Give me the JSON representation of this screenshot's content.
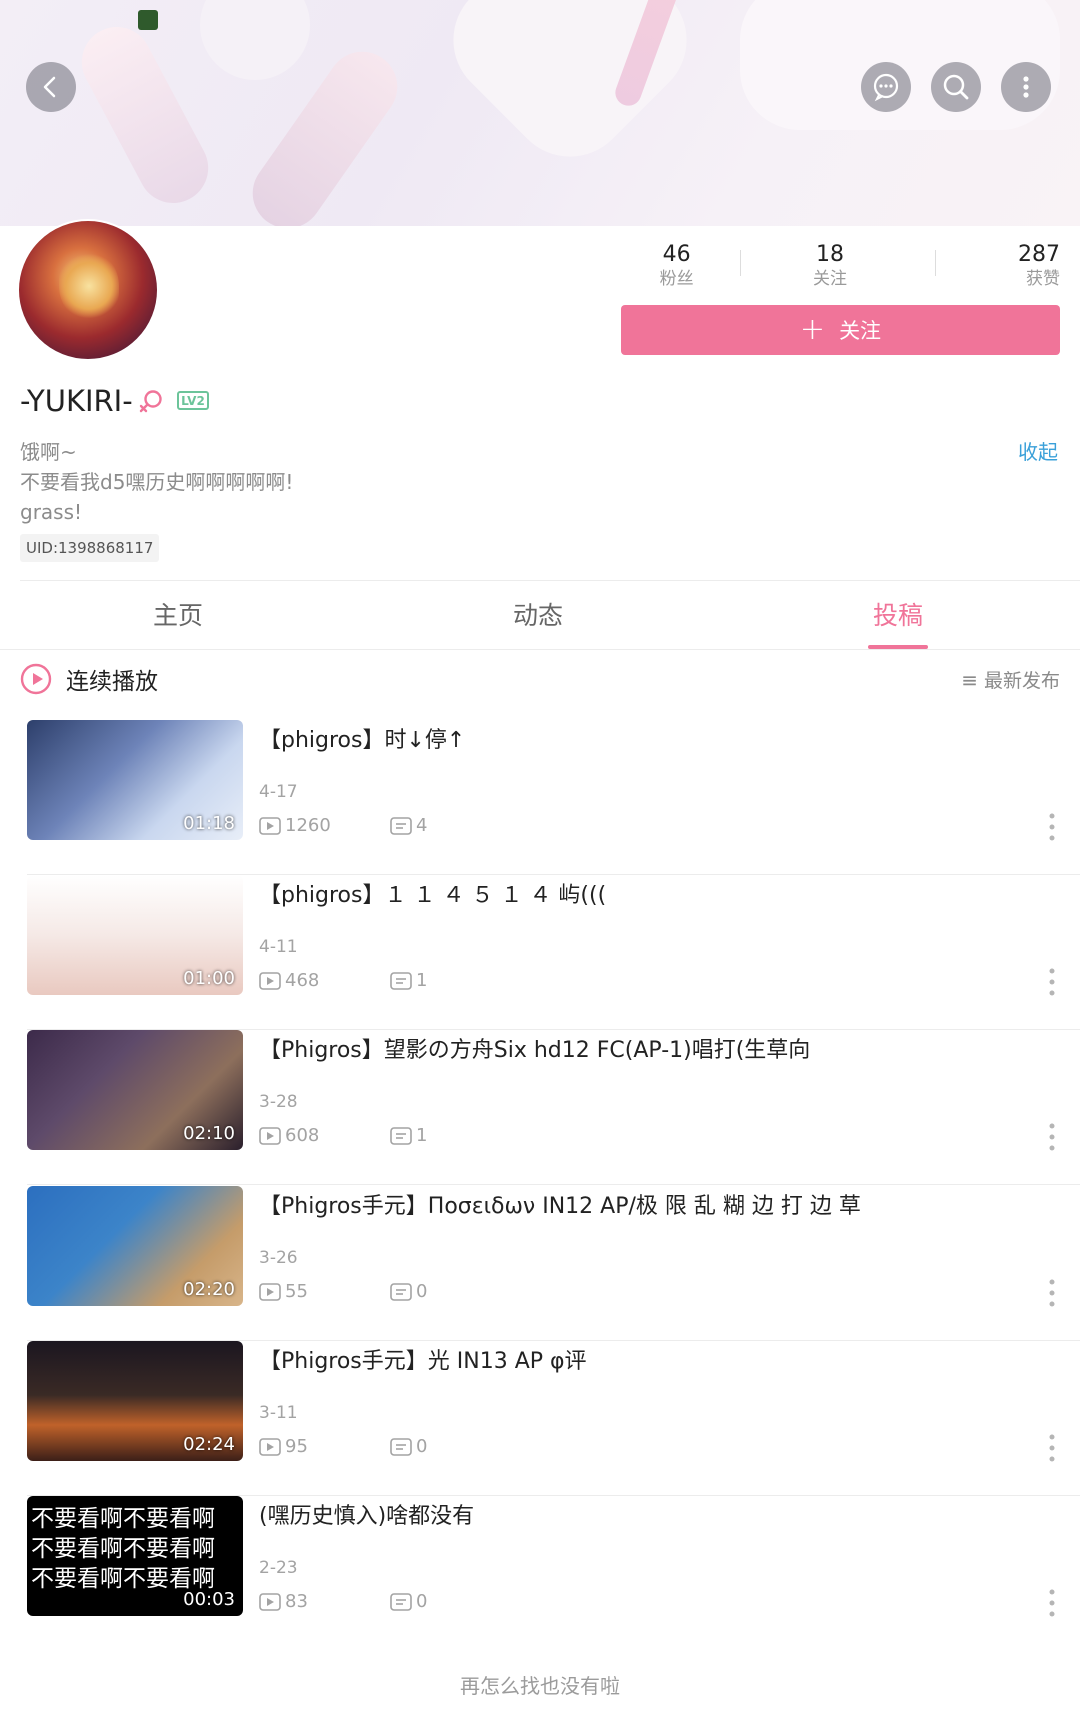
{
  "header": {
    "back_icon": "back-arrow-icon",
    "message_icon": "chat-bubble-icon",
    "search_icon": "search-icon",
    "more_icon": "more-vertical-icon"
  },
  "profile": {
    "stats": [
      {
        "value": "46",
        "label": "粉丝"
      },
      {
        "value": "18",
        "label": "关注"
      },
      {
        "value": "287",
        "label": "获赞"
      }
    ],
    "follow_label": "关注",
    "username": "-YUKIRI-",
    "level": "LV2",
    "signature": [
      "饿啊~",
      "不要看我d5嘿历史啊啊啊啊啊!",
      "grass!"
    ],
    "collapse_label": "收起",
    "uid": "UID:1398868117"
  },
  "tabs": [
    {
      "label": "主页"
    },
    {
      "label": "动态"
    },
    {
      "label": "投稿"
    }
  ],
  "play_all_label": "连续播放",
  "sort_label": "最新发布",
  "videos": [
    {
      "title": "【phigros】时↓停↑",
      "duration": "01:18",
      "date": "4-17",
      "plays": "1260",
      "comments": "4"
    },
    {
      "title": "【phigros】１ １ ４ ５ １ ４ 屿(((",
      "duration": "01:00",
      "date": "4-11",
      "plays": "468",
      "comments": "1"
    },
    {
      "title": "【Phigros】望影の方舟Six hd12 FC(AP-1)唱打(生草向",
      "duration": "02:10",
      "date": "3-28",
      "plays": "608",
      "comments": "1"
    },
    {
      "title": "【Phigros手元】Ποσειδων IN12 AP/极 限 乱 糊 边 打 边 草",
      "duration": "02:20",
      "date": "3-26",
      "plays": "55",
      "comments": "0"
    },
    {
      "title": "【Phigros手元】光 IN13 AP φ评",
      "duration": "02:24",
      "date": "3-11",
      "plays": "95",
      "comments": "0"
    },
    {
      "title": "(嘿历史慎入)啥都没有",
      "duration": "00:03",
      "date": "2-23",
      "plays": "83",
      "comments": "0",
      "thumb_text": [
        "不要看啊不要看啊",
        "不要看啊不要看啊",
        "不要看啊不要看啊"
      ]
    }
  ],
  "footer_note": "再怎么找也没有啦",
  "colors": {
    "accent": "#f07499",
    "link": "#3aa0d9",
    "level": "#6cc49a"
  }
}
